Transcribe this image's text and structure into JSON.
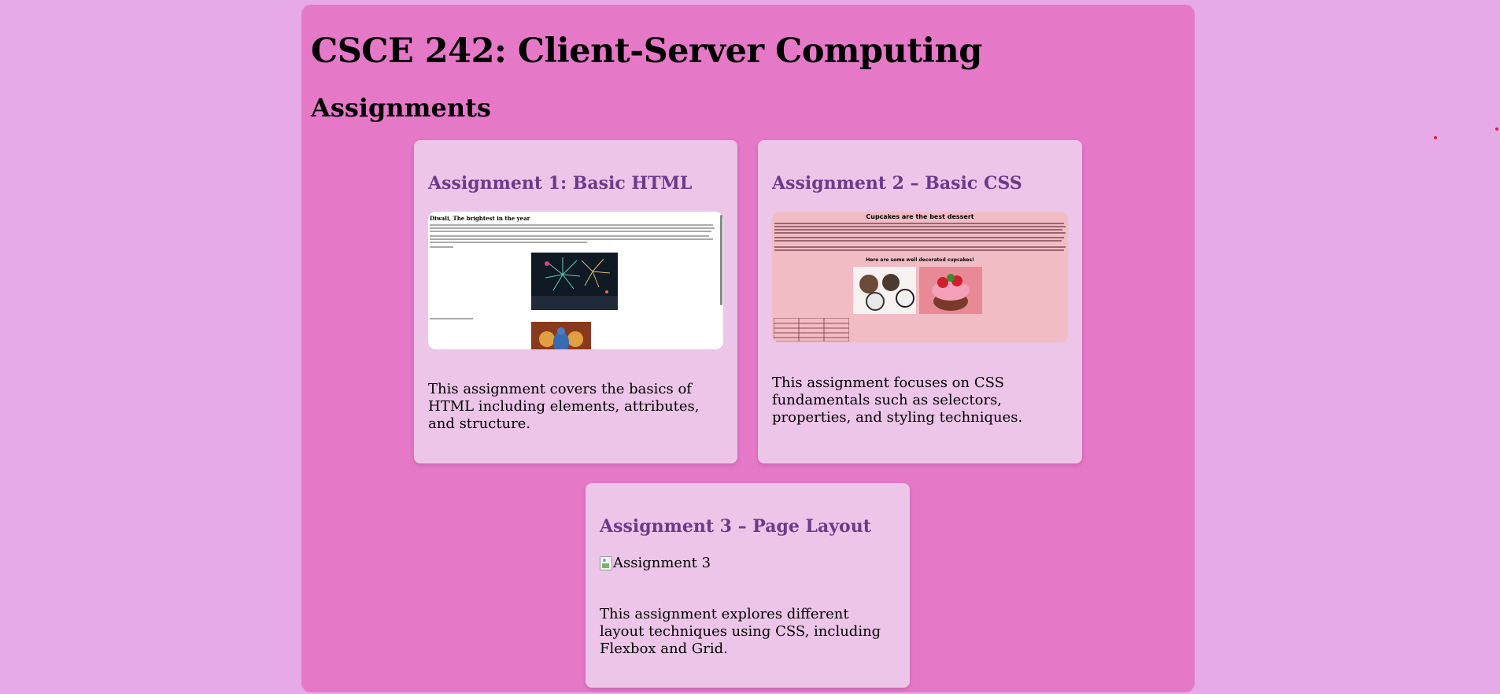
{
  "page": {
    "course_title": "CSCE 242: Client-Server Computing",
    "section_title": "Assignments"
  },
  "assignments": [
    {
      "title": "Assignment 1: Basic HTML",
      "description": "This assignment covers the basics of HTML including elements, attributes, and structure.",
      "thumbnail_heading": "Diwali, The brightest in the year"
    },
    {
      "title": "Assignment 2 – Basic CSS",
      "description": "This assignment focuses on CSS fundamentals such as selectors, properties, and styling techniques.",
      "thumbnail_heading": "Cupcakes are the best dessert",
      "thumbnail_subheading": "Here are some well decorated cupcakes!"
    },
    {
      "title": "Assignment 3 – Page Layout",
      "description": "This assignment explores different layout techniques using CSS, including Flexbox and Grid.",
      "image_alt": "Assignment 3"
    }
  ],
  "colors": {
    "page_background": "#e6aae6",
    "container_background": "#e678c8",
    "card_background": "#ecc5e8",
    "card_title": "#6c3a8a"
  }
}
